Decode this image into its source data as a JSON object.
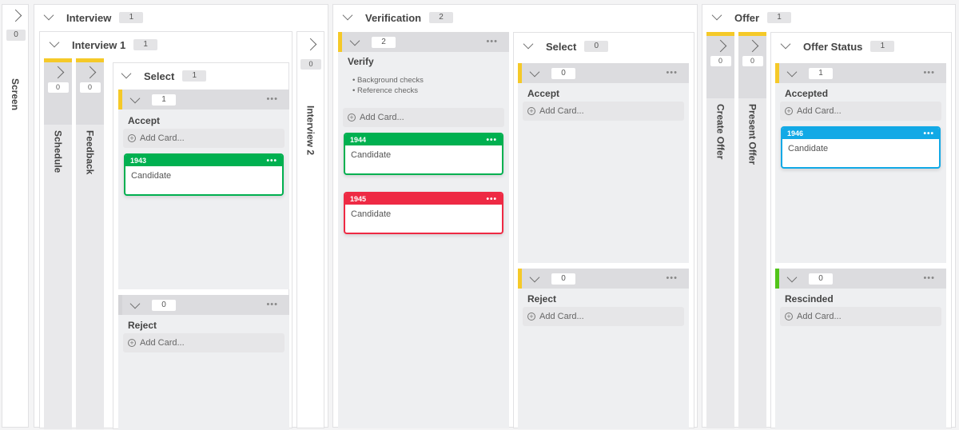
{
  "colors": {
    "stripe_yellow": "#f5c928",
    "stripe_green": "#52c41a",
    "card_green": "#00b050",
    "card_red": "#ee2a44",
    "card_blue": "#12a9e6"
  },
  "screen": {
    "label": "Screen",
    "count": "0",
    "icon": "chevron-right-icon"
  },
  "interview": {
    "title": "Interview",
    "count": "1",
    "interview1": {
      "title": "Interview 1",
      "count": "1",
      "schedule": {
        "label": "Schedule",
        "count": "0"
      },
      "feedback": {
        "label": "Feedback",
        "count": "0"
      },
      "select": {
        "title": "Select",
        "count": "1",
        "accept": {
          "title": "Accept",
          "count": "1",
          "add_card": "Add Card...",
          "cards": [
            {
              "id": "1943",
              "title": "Candidate",
              "more": "•••"
            }
          ]
        },
        "reject": {
          "title": "Reject",
          "count": "0",
          "add_card": "Add Card..."
        }
      }
    },
    "interview2": {
      "label": "Interview 2",
      "count": "0"
    }
  },
  "verification": {
    "title": "Verification",
    "count": "2",
    "verify": {
      "title": "Verify",
      "count": "2",
      "description": [
        "• Background checks",
        "• Reference checks"
      ],
      "add_card": "Add Card...",
      "cards": [
        {
          "id": "1944",
          "title": "Candidate",
          "more": "•••"
        },
        {
          "id": "1945",
          "title": "Candidate",
          "more": "•••"
        }
      ]
    },
    "select": {
      "title": "Select",
      "count": "0",
      "accept": {
        "title": "Accept",
        "count": "0",
        "add_card": "Add Card..."
      },
      "reject": {
        "title": "Reject",
        "count": "0",
        "add_card": "Add Card..."
      }
    }
  },
  "offer": {
    "title": "Offer",
    "count": "1",
    "create_offer": {
      "label": "Create Offer",
      "count": "0"
    },
    "present_offer": {
      "label": "Present Offer",
      "count": "0"
    },
    "offer_status": {
      "title": "Offer Status",
      "count": "1",
      "accepted": {
        "title": "Accepted",
        "count": "1",
        "add_card": "Add Card...",
        "cards": [
          {
            "id": "1946",
            "title": "Candidate",
            "more": "•••"
          }
        ]
      },
      "rescinded": {
        "title": "Rescinded",
        "count": "0",
        "add_card": "Add Card..."
      }
    }
  },
  "lane_more": "•••",
  "add_icon": "⊕"
}
